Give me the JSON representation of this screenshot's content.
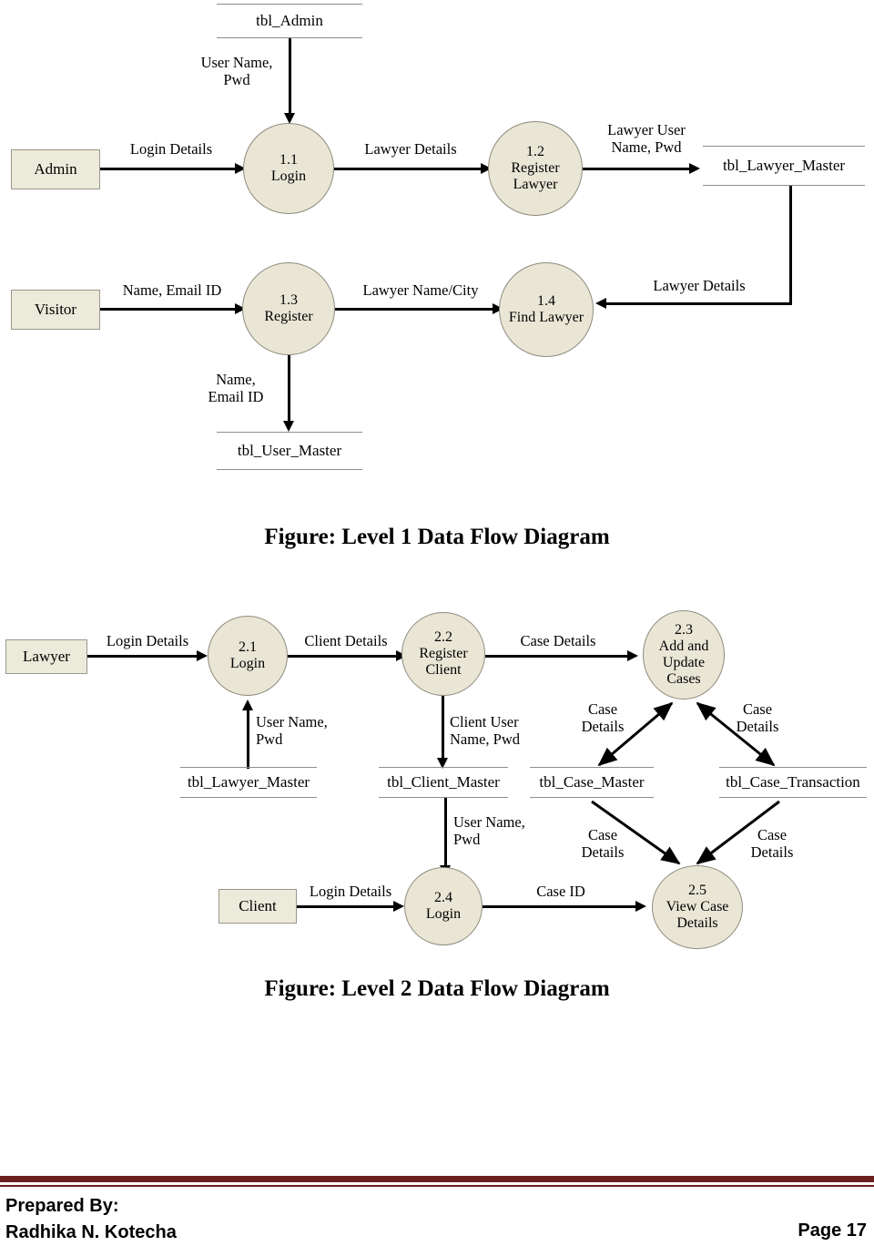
{
  "document": {
    "page_number_label": "Page 17",
    "prepared_by_label": "Prepared By:",
    "author": "Radhika N. Kotecha"
  },
  "figures": [
    {
      "id": "level1",
      "caption": "Figure: Level 1 Data Flow Diagram",
      "external_entities": [
        {
          "id": "admin",
          "label": "Admin"
        },
        {
          "id": "visitor",
          "label": "Visitor"
        }
      ],
      "processes": [
        {
          "id": "p11",
          "number": "1.1",
          "name_lines": [
            "Login"
          ]
        },
        {
          "id": "p12",
          "number": "1.2",
          "name_lines": [
            "Register",
            "Lawyer"
          ]
        },
        {
          "id": "p13",
          "number": "1.3",
          "name_lines": [
            "Register"
          ]
        },
        {
          "id": "p14",
          "number": "1.4",
          "name_lines": [
            "Find Lawyer"
          ]
        }
      ],
      "data_stores": [
        {
          "id": "tbl_admin",
          "label": "tbl_Admin"
        },
        {
          "id": "tbl_lawyer_master",
          "label": "tbl_Lawyer_Master"
        },
        {
          "id": "tbl_user_master",
          "label": "tbl_User_Master"
        }
      ],
      "flows": [
        {
          "id": "f1",
          "label": "User Name,\nPwd",
          "from": "tbl_admin",
          "to": "p11"
        },
        {
          "id": "f2",
          "label": "Login Details",
          "from": "admin",
          "to": "p11"
        },
        {
          "id": "f3",
          "label": "Lawyer Details",
          "from": "p11",
          "to": "p12"
        },
        {
          "id": "f4",
          "label": "Lawyer User\nName, Pwd",
          "from": "p12",
          "to": "tbl_lawyer_master"
        },
        {
          "id": "f5",
          "label": "Name, Email ID",
          "from": "visitor",
          "to": "p13"
        },
        {
          "id": "f6",
          "label": "Lawyer Name/City",
          "from": "p13",
          "to": "p14"
        },
        {
          "id": "f7",
          "label": "Lawyer Details",
          "from": "tbl_lawyer_master",
          "to": "p14"
        },
        {
          "id": "f8",
          "label": "Name,\nEmail ID",
          "from": "p13",
          "to": "tbl_user_master"
        }
      ]
    },
    {
      "id": "level2",
      "caption": "Figure: Level 2 Data Flow Diagram",
      "external_entities": [
        {
          "id": "lawyer",
          "label": "Lawyer"
        },
        {
          "id": "client",
          "label": "Client"
        }
      ],
      "processes": [
        {
          "id": "p21",
          "number": "2.1",
          "name_lines": [
            "Login"
          ]
        },
        {
          "id": "p22",
          "number": "2.2",
          "name_lines": [
            "Register",
            "Client"
          ]
        },
        {
          "id": "p23",
          "number": "2.3",
          "name_lines": [
            "Add and",
            "Update",
            "Cases"
          ]
        },
        {
          "id": "p24",
          "number": "2.4",
          "name_lines": [
            "Login"
          ]
        },
        {
          "id": "p25",
          "number": "2.5",
          "name_lines": [
            "View Case",
            "Details"
          ]
        }
      ],
      "data_stores": [
        {
          "id": "tbl_lawyer_master2",
          "label": "tbl_Lawyer_Master"
        },
        {
          "id": "tbl_client_master",
          "label": "tbl_Client_Master"
        },
        {
          "id": "tbl_case_master",
          "label": "tbl_Case_Master"
        },
        {
          "id": "tbl_case_transaction",
          "label": "tbl_Case_Transaction"
        }
      ],
      "flows": [
        {
          "id": "g1",
          "label": "Login Details",
          "from": "lawyer",
          "to": "p21"
        },
        {
          "id": "g2",
          "label": "Client Details",
          "from": "p21",
          "to": "p22"
        },
        {
          "id": "g3",
          "label": "Case Details",
          "from": "p22",
          "to": "p23"
        },
        {
          "id": "g4",
          "label": "User Name,\nPwd",
          "from": "tbl_lawyer_master2",
          "to": "p21"
        },
        {
          "id": "g5",
          "label": "Client User\nName, Pwd",
          "from": "p22",
          "to": "tbl_client_master"
        },
        {
          "id": "g6",
          "label": "Case\nDetails",
          "from": "p23",
          "to": "tbl_case_master"
        },
        {
          "id": "g7",
          "label": "Case\nDetails",
          "from": "p23",
          "to": "tbl_case_transaction"
        },
        {
          "id": "g8",
          "label": "User Name,\nPwd",
          "from": "tbl_client_master",
          "to": "p24"
        },
        {
          "id": "g9",
          "label": "Login Details",
          "from": "client",
          "to": "p24"
        },
        {
          "id": "g10",
          "label": "Case ID",
          "from": "p24",
          "to": "p25"
        },
        {
          "id": "g11",
          "label": "Case\nDetails",
          "from": "tbl_case_master",
          "to": "p25"
        },
        {
          "id": "g12",
          "label": "Case\nDetails",
          "from": "tbl_case_transaction",
          "to": "p25"
        }
      ]
    }
  ],
  "colors": {
    "entity_fill": "#ECEADA",
    "process_fill": "#E9E6D6",
    "rule": "#6B2020",
    "line": "#000000"
  }
}
